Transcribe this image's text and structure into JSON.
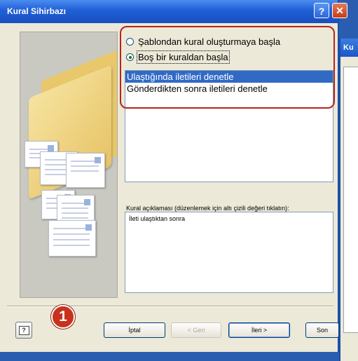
{
  "background_window": {
    "title": "Ku"
  },
  "dialog": {
    "title": "Kural Sihirbazı",
    "help_symbol": "?",
    "close_symbol": "✕"
  },
  "options": {
    "radio_template": "Şablondan kural oluşturmaya başla",
    "radio_blank": "Boş bir kuraldan başla",
    "selected_radio": "blank"
  },
  "rule_list": {
    "items": [
      {
        "label": "Ulaştığında iletileri denetle",
        "selected": true
      },
      {
        "label": "Gönderdikten sonra iletileri denetle",
        "selected": false
      }
    ]
  },
  "description": {
    "label": "Kural açıklaması (düzenlemek için altı çizili değeri tıklatın):",
    "text": "İleti ulaştıktan sonra"
  },
  "buttons": {
    "cancel": "İptal",
    "back": "< Geri",
    "next": "İleri >",
    "finish": "Son"
  },
  "callout_number": "1",
  "colors": {
    "title_bar": "#1f5fd6",
    "selection": "#316ac5",
    "highlight_outline": "#b6251b",
    "callout_badge": "#c8321c"
  }
}
